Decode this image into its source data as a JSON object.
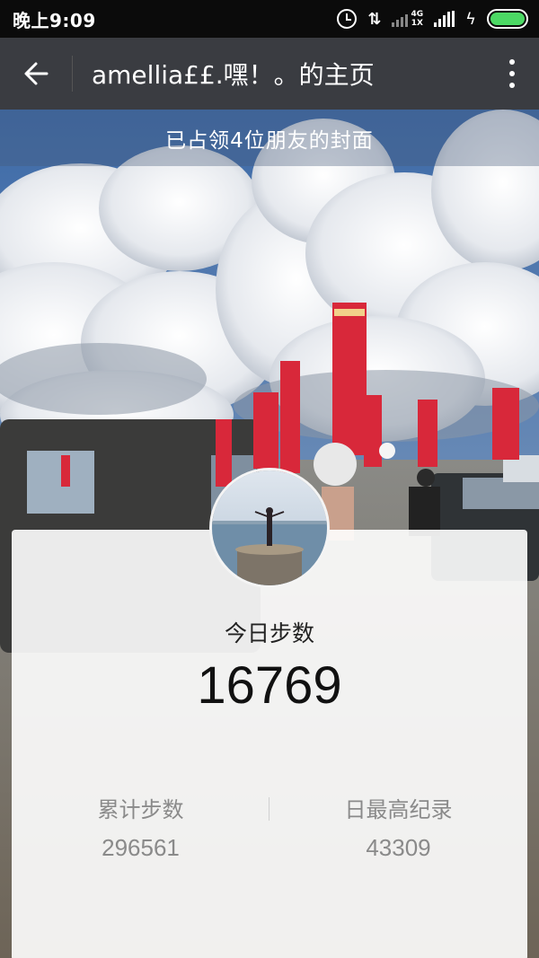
{
  "status_bar": {
    "time": "晚上9:09",
    "network_type": "4G",
    "network_sub": "1X",
    "icons": [
      "alarm-icon",
      "data-transfer-icon",
      "signal-icon",
      "charging-icon",
      "battery-icon"
    ],
    "battery_color": "#4cd964"
  },
  "app_bar": {
    "title": "amellia££.嘿！。的主页",
    "back_icon": "back-arrow-icon",
    "menu_icon": "more-vertical-icon",
    "background": "#3a3c41"
  },
  "cover": {
    "banner_text": "已占领4位朋友的封面"
  },
  "stats": {
    "today_label": "今日步数",
    "today_steps": "16769",
    "total_label": "累计步数",
    "total_steps": "296561",
    "record_label": "日最高纪录",
    "record_steps": "43309"
  }
}
